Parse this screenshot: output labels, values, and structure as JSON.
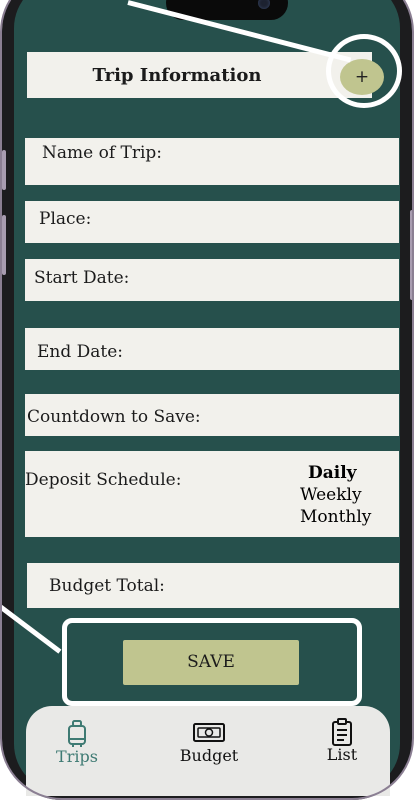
{
  "header": {
    "title": "Trip Information",
    "add_label": "+"
  },
  "fields": {
    "name": "Name of Trip:",
    "place": "Place:",
    "start_date": "Start Date:",
    "end_date": "End Date:",
    "countdown": "Countdown to Save:",
    "deposit": "Deposit Schedule:",
    "budget_total": "Budget Total:"
  },
  "deposit_options": [
    "Daily",
    "Weekly",
    "Monthly"
  ],
  "save_label": "SAVE",
  "tabs": [
    {
      "label": "Trips",
      "icon": "luggage-icon",
      "active": true
    },
    {
      "label": "Budget",
      "icon": "money-icon",
      "active": false
    },
    {
      "label": "List",
      "icon": "clipboard-icon",
      "active": false
    }
  ],
  "colors": {
    "screen_bg": "#26504c",
    "card_bg": "#f2f1ec",
    "accent": "#c0c58f",
    "tab_active": "#3e7a73",
    "annotation": "#ffffff"
  }
}
